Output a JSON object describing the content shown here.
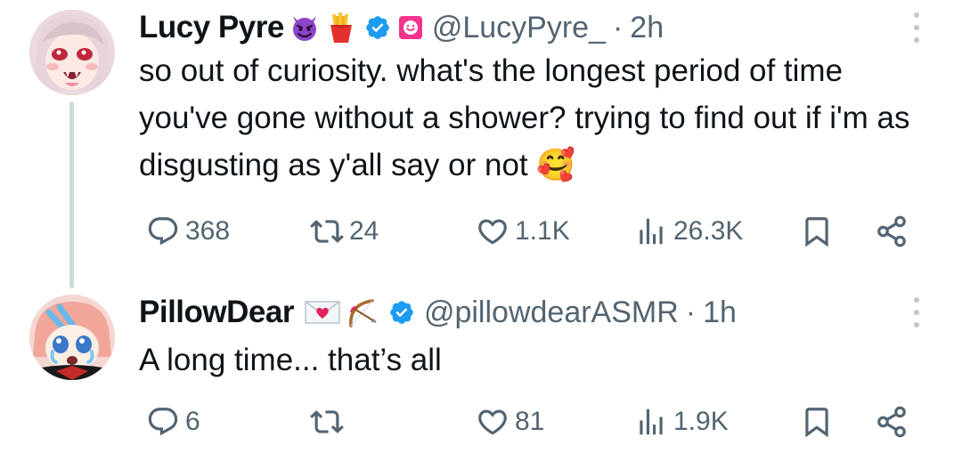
{
  "tweets": [
    {
      "name": "Lucy Pyre",
      "name_emojis": [
        "😈",
        "🍟"
      ],
      "handle": "@LucyPyre_",
      "separator": "·",
      "time": "2h",
      "text": "so out of curiosity. what's the longest period of time you've gone without a shower? trying to find out if i'm as disgusting as y'all say or not 🥰",
      "replies": "368",
      "retweets": "24",
      "likes": "1.1K",
      "views": "26.3K"
    },
    {
      "name": "PillowDear",
      "name_emojis": [
        "💌",
        "🏹"
      ],
      "handle": "@pillowdearASMR",
      "separator": "·",
      "time": "1h",
      "text": "A long time... that’s all",
      "replies": "6",
      "retweets": "",
      "likes": "81",
      "views": "1.9K"
    }
  ],
  "colors": {
    "verified": "#1d9bf0",
    "muted": "#536471",
    "thread_line": "#cfd9de",
    "affiliate_badge": "#f4338c"
  },
  "icons": {
    "reply": "reply-icon",
    "retweet": "retweet-icon",
    "like": "heart-icon",
    "views": "views-icon",
    "bookmark": "bookmark-icon",
    "share": "share-icon",
    "more": "more-vertical-icon"
  }
}
